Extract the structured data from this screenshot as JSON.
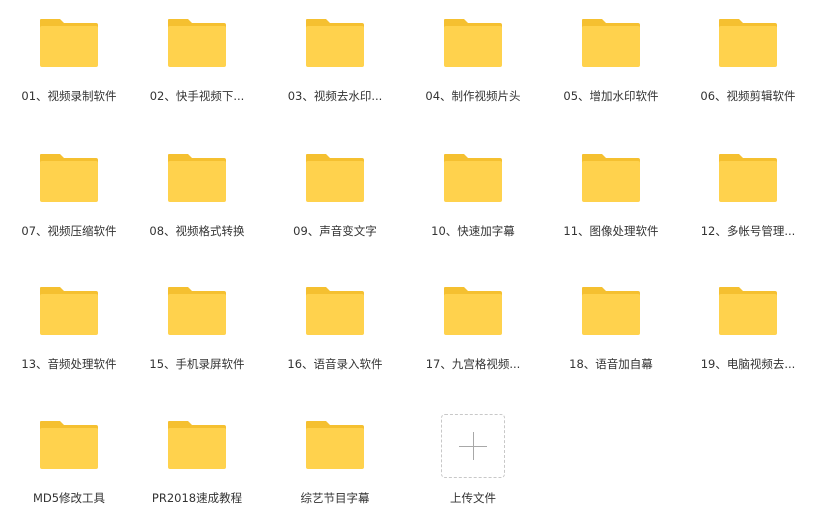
{
  "folders": [
    {
      "name": "01、视频录制软件"
    },
    {
      "name": "02、快手视频下..."
    },
    {
      "name": "03、视频去水印..."
    },
    {
      "name": "04、制作视频片头"
    },
    {
      "name": "05、增加水印软件"
    },
    {
      "name": "06、视频剪辑软件"
    },
    {
      "name": "07、视频压缩软件"
    },
    {
      "name": "08、视频格式转换"
    },
    {
      "name": "09、声音变文字"
    },
    {
      "name": "10、快速加字幕"
    },
    {
      "name": "11、图像处理软件"
    },
    {
      "name": "12、多帐号管理..."
    },
    {
      "name": "13、音频处理软件"
    },
    {
      "name": "15、手机录屏软件"
    },
    {
      "name": "16、语音录入软件"
    },
    {
      "name": "17、九宫格视频..."
    },
    {
      "name": "18、语音加自幕"
    },
    {
      "name": "19、电脑视频去..."
    },
    {
      "name": "MD5修改工具"
    },
    {
      "name": "PR2018速成教程"
    },
    {
      "name": "综艺节目字幕"
    }
  ],
  "upload": {
    "label": "上传文件",
    "icon": "plus-icon"
  },
  "colors": {
    "folder_body": "#FFD24D",
    "folder_tab": "#F5C030",
    "text": "#333333",
    "upload_border": "#C8C8C8"
  }
}
